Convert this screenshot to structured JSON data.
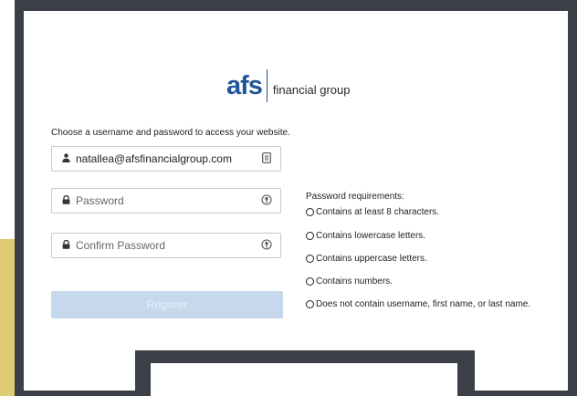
{
  "logo": {
    "mark": "afs",
    "subtitle": "financial group"
  },
  "intro_text": "Choose a username and password to access your website.",
  "fields": {
    "username": {
      "value": "natallea@afsfinancialgroup.com"
    },
    "password": {
      "placeholder": "Password"
    },
    "confirm_password": {
      "placeholder": "Confirm Password"
    }
  },
  "register_label": "Register",
  "requirements": {
    "title": "Password requirements:",
    "items": [
      "Contains at least 8 characters.",
      "Contains lowercase letters.",
      "Contains uppercase letters.",
      "Contains numbers.",
      "Does not contain username, first name, or last name."
    ]
  },
  "colors": {
    "brand": "#1f5697",
    "frame": "#3a4045",
    "accent": "#dccb72",
    "button_disabled": "#c6d8ec"
  }
}
